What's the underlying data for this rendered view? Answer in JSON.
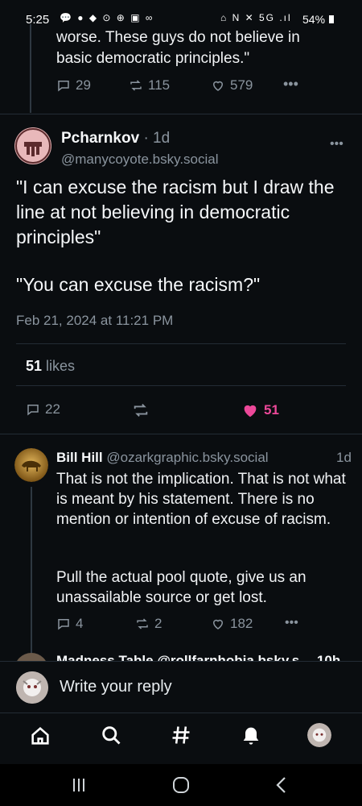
{
  "status_bar": {
    "time": "5:25",
    "left_icons": "💬 ● ◆ ⊙ ⊕ ▣ ∞",
    "right_icons": "⌂ N ✕ 5G .ıl",
    "battery": "54%"
  },
  "prev_post": {
    "text_line1": "worse. These guys do not believe in",
    "text_line2": "basic democratic principles.\"",
    "replies": "29",
    "reposts": "115",
    "likes": "579"
  },
  "main_post": {
    "author": "Pcharnkov",
    "age": "· 1d",
    "handle": "@manycoyote.bsky.social",
    "text_p1": "\"I can excuse the racism but I draw the line at not believing in democratic principles\"",
    "text_p2": "\"You can excuse the racism?\"",
    "timestamp": "Feb 21, 2024 at 11:21 PM",
    "likes_count": "51",
    "likes_label": "likes",
    "replies": "22",
    "likes": "51"
  },
  "reply": {
    "author": "Bill Hill",
    "handle": "@ozarkgraphic.bsky.social",
    "age": "1d",
    "text_p1": "That is not the implication. That is not what is meant by his statement. There is no mention or intention of excuse of racism.",
    "text_p2": "Pull the actual pool quote, give us an unassailable source or get lost.",
    "replies": "4",
    "reposts": "2",
    "likes": "182"
  },
  "next_reply_peek": {
    "text": "Madness Table @rollfarnhobia.bsky.s… 10h"
  },
  "composer": {
    "placeholder": "Write your reply"
  },
  "colors": {
    "background": "#0a0d10",
    "like_pink": "#ec4899",
    "muted": "#8a949e"
  },
  "icons": [
    "home-icon",
    "search-icon",
    "hashtag-icon",
    "bell-icon",
    "avatar"
  ]
}
